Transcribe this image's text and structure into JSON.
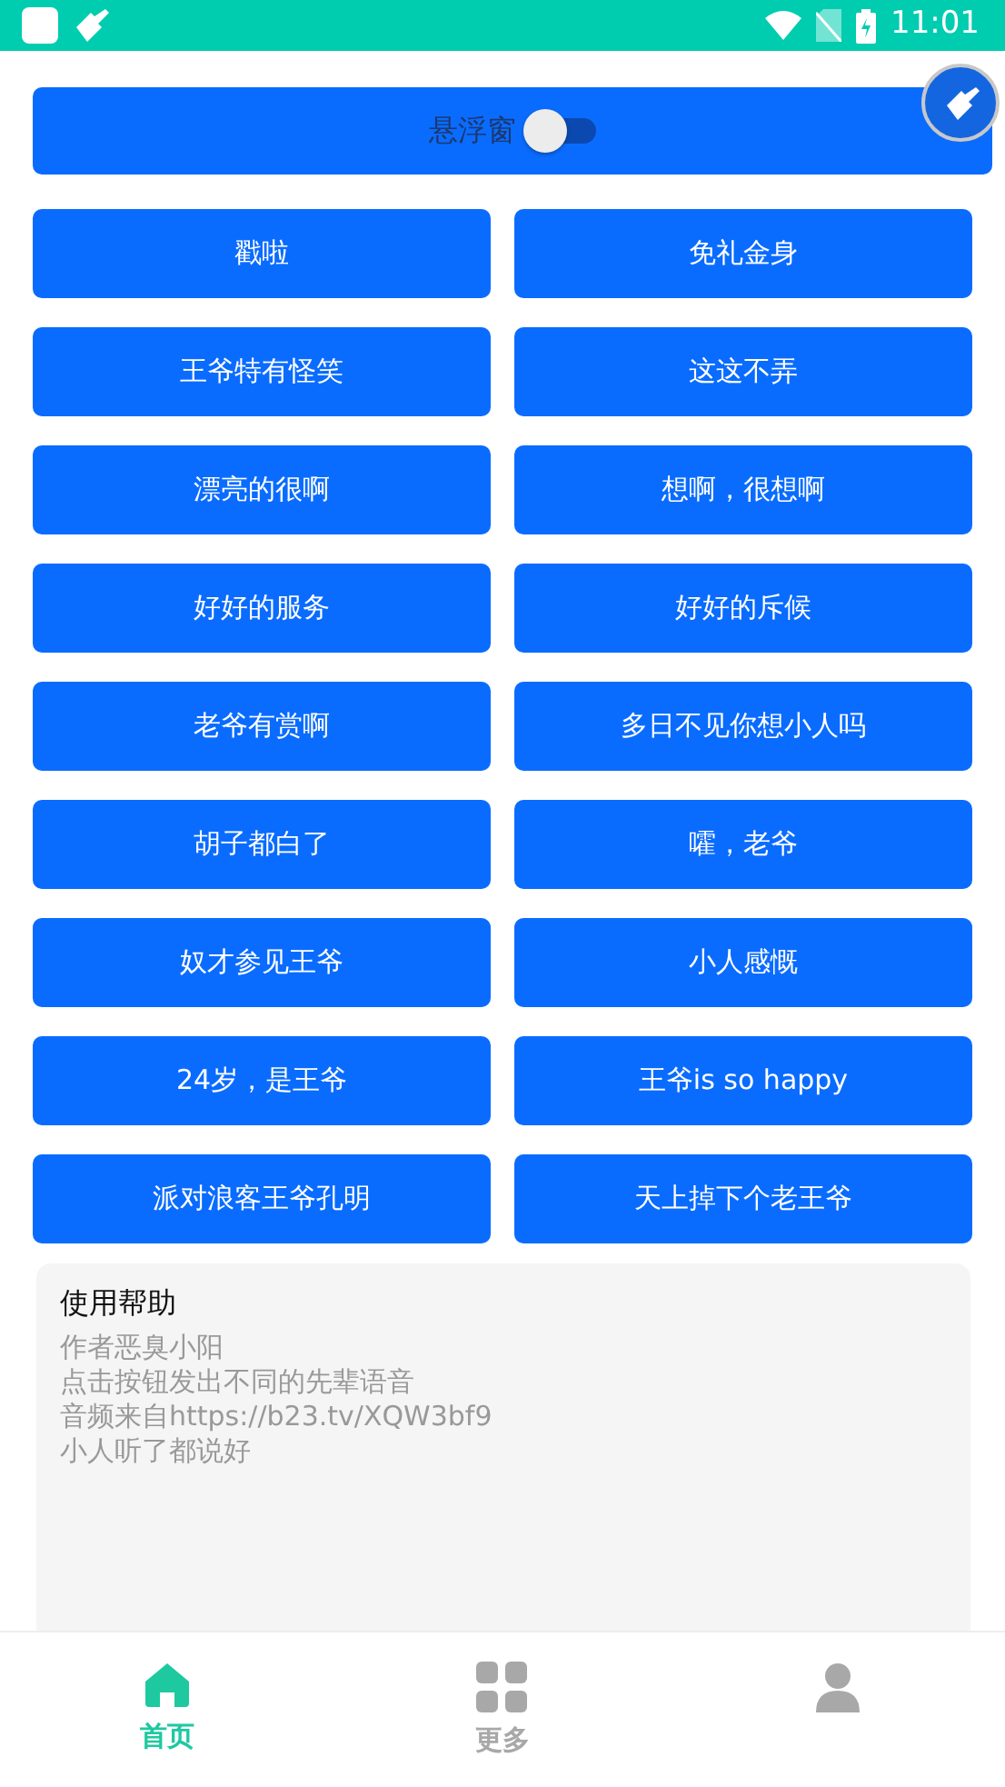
{
  "status_bar": {
    "time": "11:01"
  },
  "float_toggle": {
    "label": "悬浮窗",
    "on": false
  },
  "sound_buttons": [
    {
      "label": "戳啦"
    },
    {
      "label": "免礼金身"
    },
    {
      "label": "王爷特有怪笑"
    },
    {
      "label": "这这不弄"
    },
    {
      "label": "漂亮的很啊"
    },
    {
      "label": "想啊，很想啊"
    },
    {
      "label": "好好的服务"
    },
    {
      "label": "好好的斥候"
    },
    {
      "label": "老爷有赏啊"
    },
    {
      "label": "多日不见你想小人吗"
    },
    {
      "label": "胡子都白了"
    },
    {
      "label": "嚯，老爷"
    },
    {
      "label": "奴才参见王爷"
    },
    {
      "label": "小人感慨"
    },
    {
      "label": "24岁，是王爷"
    },
    {
      "label": "王爷is so happy"
    },
    {
      "label": "派对浪客王爷孔明"
    },
    {
      "label": "天上掉下个老王爷"
    }
  ],
  "help": {
    "title": "使用帮助",
    "lines": [
      "作者恶臭小阳",
      "点击按钮发出不同的先辈语音",
      "音频来自https://b23.tv/XQW3bf9",
      "小人听了都说好"
    ]
  },
  "bottom_nav": [
    {
      "kind": "home",
      "label": "首页",
      "selected": true
    },
    {
      "kind": "grid",
      "label": "更多",
      "selected": false
    },
    {
      "kind": "person",
      "selected": false
    }
  ]
}
